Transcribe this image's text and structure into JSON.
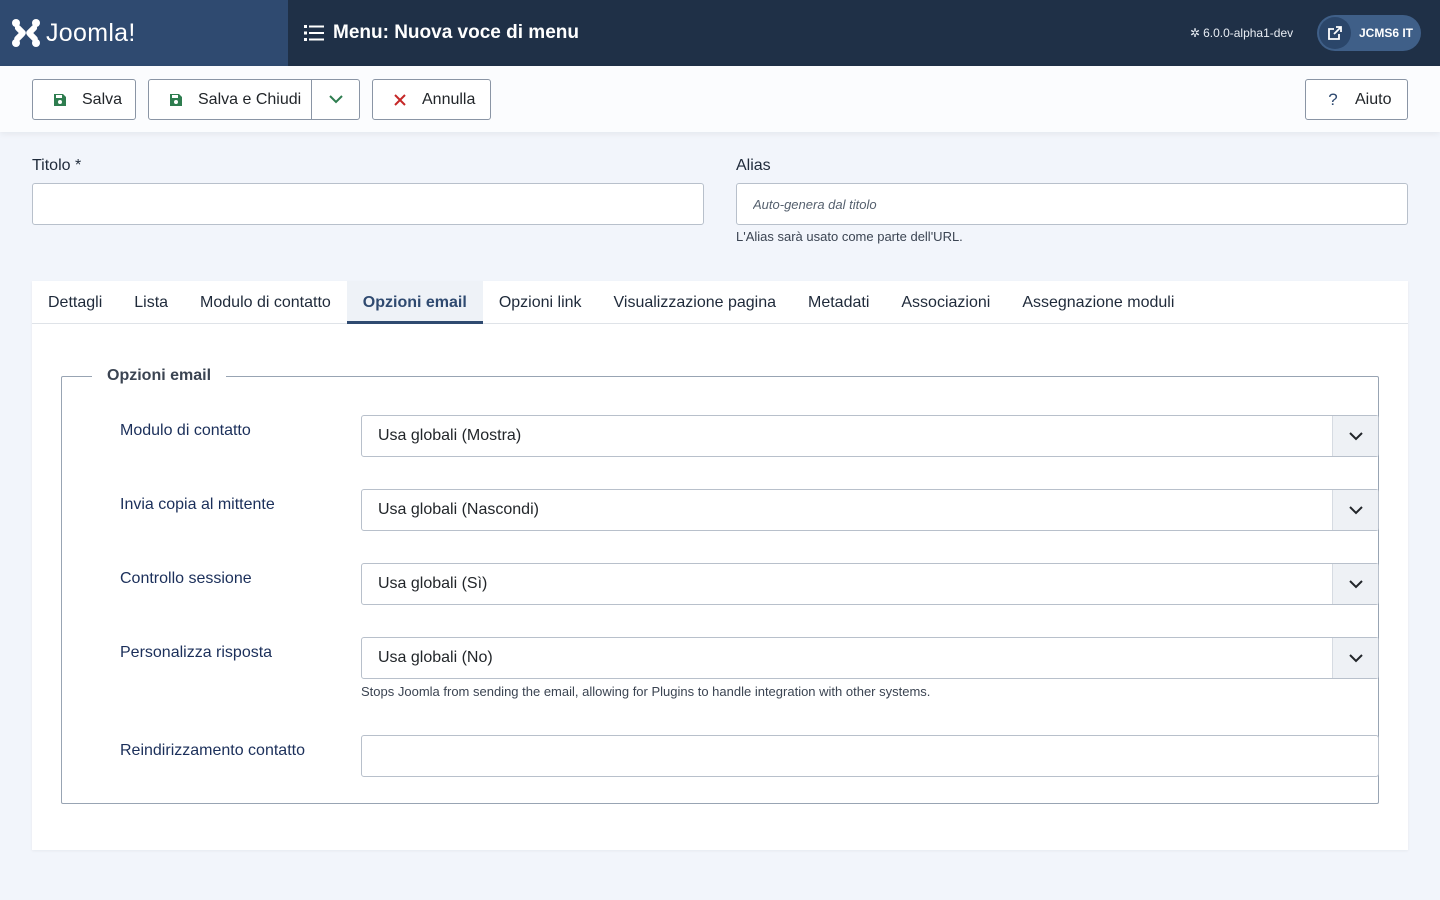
{
  "header": {
    "brand": "Joomla!",
    "title": "Menu: Nuova voce di menu",
    "version": "6.0.0-alpha1-dev",
    "site_label": "JCMS6 IT",
    "colors": {
      "header_bg": "#1f3047",
      "logo_bg": "#2f4a70",
      "accent": "#2f4a70"
    }
  },
  "toolbar": {
    "save": "Salva",
    "save_close": "Salva e Chiudi",
    "cancel": "Annulla",
    "help": "Aiuto",
    "icons": {
      "save": "floppy-disk-icon",
      "cancel": "x-icon",
      "help": "question-icon",
      "dropdown": "chevron-down-icon"
    }
  },
  "form": {
    "title_label": "Titolo *",
    "title_value": "",
    "alias_label": "Alias",
    "alias_placeholder": "Auto-genera dal titolo",
    "alias_help": "L'Alias sarà usato come parte dell'URL."
  },
  "tabs": [
    {
      "label": "Dettagli",
      "active": false
    },
    {
      "label": "Lista",
      "active": false
    },
    {
      "label": "Modulo di contatto",
      "active": false
    },
    {
      "label": "Opzioni email",
      "active": true
    },
    {
      "label": "Opzioni link",
      "active": false
    },
    {
      "label": "Visualizzazione pagina",
      "active": false
    },
    {
      "label": "Metadati",
      "active": false
    },
    {
      "label": "Associazioni",
      "active": false
    },
    {
      "label": "Assegnazione moduli",
      "active": false
    }
  ],
  "email_options": {
    "legend": "Opzioni email",
    "fields": [
      {
        "label": "Modulo di contatto",
        "value": "Usa globali (Mostra)"
      },
      {
        "label": "Invia copia al mittente",
        "value": "Usa globali (Nascondi)"
      },
      {
        "label": "Controllo sessione",
        "value": "Usa globali (Sì)"
      },
      {
        "label": "Personalizza risposta",
        "value": "Usa globali (No)",
        "help": "Stops Joomla from sending the email, allowing for Plugins to handle integration with other systems."
      }
    ],
    "redirect_label": "Reindirizzamento contatto",
    "redirect_value": ""
  }
}
